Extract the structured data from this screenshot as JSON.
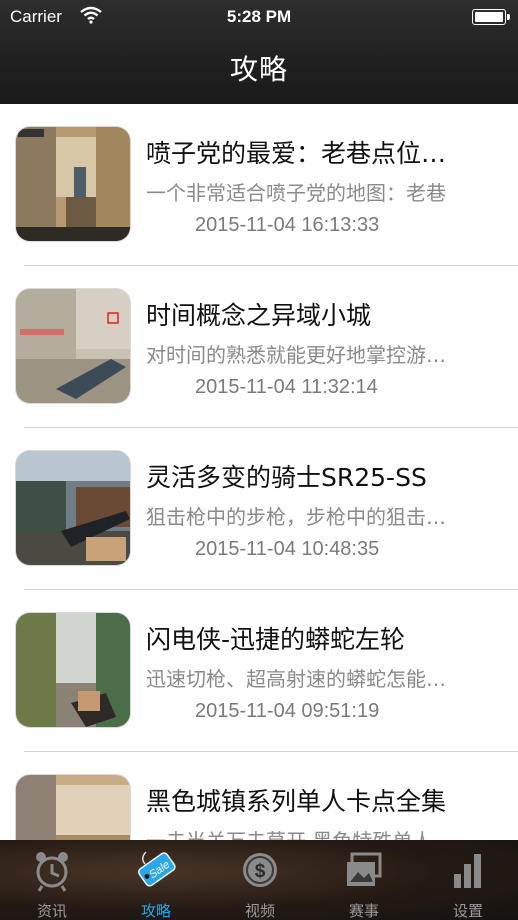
{
  "status_bar": {
    "carrier": "Carrier",
    "time": "5:28 PM"
  },
  "nav": {
    "title": "攻略"
  },
  "articles": [
    {
      "title": "喷子党的最爱：老巷点位…",
      "summary": "一个非常适合喷子党的地图：老巷",
      "date": "2015-11-04 16:13:33"
    },
    {
      "title": "时间概念之异域小城",
      "summary": "对时间的熟悉就能更好地掌控游…",
      "date": "2015-11-04 11:32:14"
    },
    {
      "title": "灵活多变的骑士SR25-SS",
      "summary": "狙击枪中的步枪，步枪中的狙击…",
      "date": "2015-11-04 10:48:35"
    },
    {
      "title": "闪电侠-迅捷的蟒蛇左轮",
      "summary": "迅速切枪、超高射速的蟒蛇怎能…",
      "date": "2015-11-04 09:51:19"
    },
    {
      "title": "黑色城镇系列单人卡点全集",
      "summary": "一夫当关万夫莫开 黑色特殊单人",
      "date": ""
    }
  ],
  "tabs": [
    {
      "label": "资讯",
      "icon": "alarm-clock-icon",
      "active": false
    },
    {
      "label": "攻略",
      "icon": "sale-tag-icon",
      "active": true
    },
    {
      "label": "视频",
      "icon": "dollar-coin-icon",
      "active": false
    },
    {
      "label": "赛事",
      "icon": "photo-frame-icon",
      "active": false
    },
    {
      "label": "设置",
      "icon": "bar-chart-icon",
      "active": false
    }
  ],
  "colors": {
    "accent": "#2aa7e8",
    "header_bg": "#222222",
    "tab_inactive": "#9a9a9a"
  }
}
